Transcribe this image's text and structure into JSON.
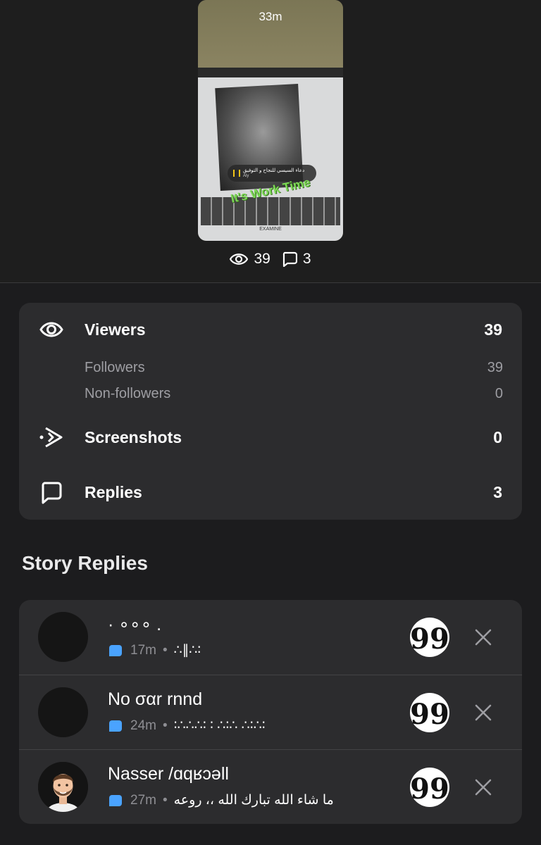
{
  "story": {
    "time_ago": "33m",
    "music_title": "دعاء السيسي للنجاح و التوفيق",
    "music_artist": "Aly",
    "sticker_text": "It's Work Time",
    "brand_text": "EXAMINE",
    "view_count": "39",
    "reply_count": "3"
  },
  "insights": {
    "viewers": {
      "label": "Viewers",
      "value": "39",
      "icon": "eye-icon"
    },
    "followers": {
      "label": "Followers",
      "value": "39"
    },
    "non_followers": {
      "label": "Non-followers",
      "value": "0"
    },
    "screenshots": {
      "label": "Screenshots",
      "value": "0",
      "icon": "screenshot-icon"
    },
    "replies": {
      "label": "Replies",
      "value": "3",
      "icon": "reply-bubble-icon"
    }
  },
  "story_replies": {
    "title": "Story Replies",
    "items": [
      {
        "name": "· ∘∘∘ .",
        "time": "17m",
        "text": "∴∥∴∶",
        "avatar": "blank"
      },
      {
        "name": "Νo σαr rnnd",
        "time": "24m",
        "text": "∶∴∴∴∶ ∶ ∴∶∴ ∴∶∴∶",
        "avatar": "blank"
      },
      {
        "name": "Nasser /ɑqʁɔəll",
        "time": "27m",
        "text": "ما شاء الله تبارك الله ،، روعه",
        "avatar": "bitmoji"
      }
    ],
    "quote_glyph": "99"
  },
  "colors": {
    "background": "#1c1c1e",
    "card": "#2c2c2e",
    "accent_blue": "#4aa3ff",
    "muted_text": "#9e9ea3"
  }
}
